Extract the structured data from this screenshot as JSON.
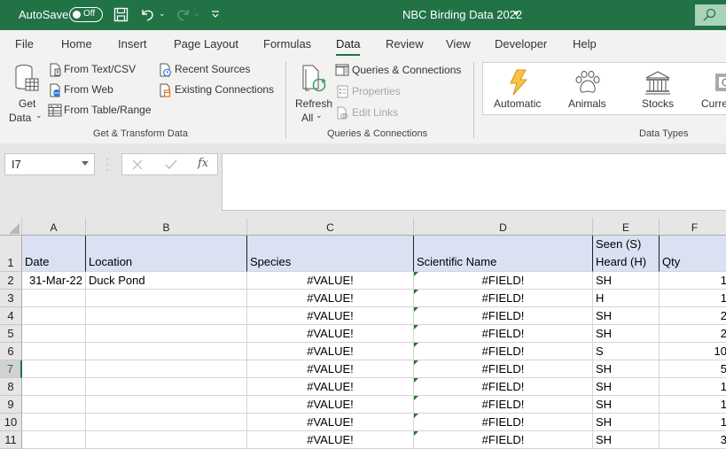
{
  "titlebar": {
    "autosave_label": "AutoSave",
    "autosave_state": "Off",
    "document_title": "NBC Birding Data 2022",
    "icons": [
      "save-icon",
      "undo-icon",
      "redo-icon",
      "customize-qat-icon",
      "search-icon"
    ]
  },
  "tabs": [
    {
      "label": "File"
    },
    {
      "label": "Home"
    },
    {
      "label": "Insert"
    },
    {
      "label": "Page Layout"
    },
    {
      "label": "Formulas"
    },
    {
      "label": "Data",
      "active": true
    },
    {
      "label": "Review"
    },
    {
      "label": "View"
    },
    {
      "label": "Developer"
    },
    {
      "label": "Help"
    }
  ],
  "ribbon": {
    "get_transform": {
      "label": "Get & Transform Data",
      "get_data_line1": "Get",
      "get_data_line2": "Data",
      "from_text_csv": "From Text/CSV",
      "from_web": "From Web",
      "from_table_range": "From Table/Range",
      "recent_sources": "Recent Sources",
      "existing_connections": "Existing Connections"
    },
    "queries": {
      "label": "Queries & Connections",
      "refresh_line1": "Refresh",
      "refresh_line2": "All",
      "queries_connections": "Queries & Connections",
      "properties": "Properties",
      "edit_links": "Edit Links"
    },
    "data_types": {
      "label": "Data Types",
      "automatic": "Automatic",
      "animals": "Animals",
      "stocks": "Stocks",
      "currencies": "Curre"
    }
  },
  "formula_bar": {
    "name_box": "I7",
    "fx_label": "fx",
    "formula": ""
  },
  "sheet": {
    "columns": [
      "A",
      "B",
      "C",
      "D",
      "E",
      "F"
    ],
    "header_row": {
      "row_number": "1",
      "cells": [
        "Date",
        "Location",
        "Species",
        "Scientific Name",
        "Seen (S)",
        "Qty"
      ],
      "e_line2": "Heard (H)"
    },
    "rows": [
      {
        "n": "2",
        "date": "31-Mar-22",
        "location": "Duck Pond",
        "species": "#VALUE!",
        "scientific": "#FIELD!",
        "seen": "SH",
        "qty": "1"
      },
      {
        "n": "3",
        "date": "",
        "location": "",
        "species": "#VALUE!",
        "scientific": "#FIELD!",
        "seen": "H",
        "qty": "1"
      },
      {
        "n": "4",
        "date": "",
        "location": "",
        "species": "#VALUE!",
        "scientific": "#FIELD!",
        "seen": "SH",
        "qty": "2"
      },
      {
        "n": "5",
        "date": "",
        "location": "",
        "species": "#VALUE!",
        "scientific": "#FIELD!",
        "seen": "SH",
        "qty": "2"
      },
      {
        "n": "6",
        "date": "",
        "location": "",
        "species": "#VALUE!",
        "scientific": "#FIELD!",
        "seen": "S",
        "qty": "10"
      },
      {
        "n": "7",
        "date": "",
        "location": "",
        "species": "#VALUE!",
        "scientific": "#FIELD!",
        "seen": "SH",
        "qty": "5"
      },
      {
        "n": "8",
        "date": "",
        "location": "",
        "species": "#VALUE!",
        "scientific": "#FIELD!",
        "seen": "SH",
        "qty": "1"
      },
      {
        "n": "9",
        "date": "",
        "location": "",
        "species": "#VALUE!",
        "scientific": "#FIELD!",
        "seen": "SH",
        "qty": "1"
      },
      {
        "n": "10",
        "date": "",
        "location": "",
        "species": "#VALUE!",
        "scientific": "#FIELD!",
        "seen": "SH",
        "qty": "1"
      },
      {
        "n": "11",
        "date": "",
        "location": "",
        "species": "#VALUE!",
        "scientific": "#FIELD!",
        "seen": "SH",
        "qty": "3"
      }
    ],
    "selected_row": "7",
    "colors": {
      "header_fill": "#d9e1f2",
      "accent": "#217346",
      "error_indicator": "#1e7a1e"
    }
  }
}
